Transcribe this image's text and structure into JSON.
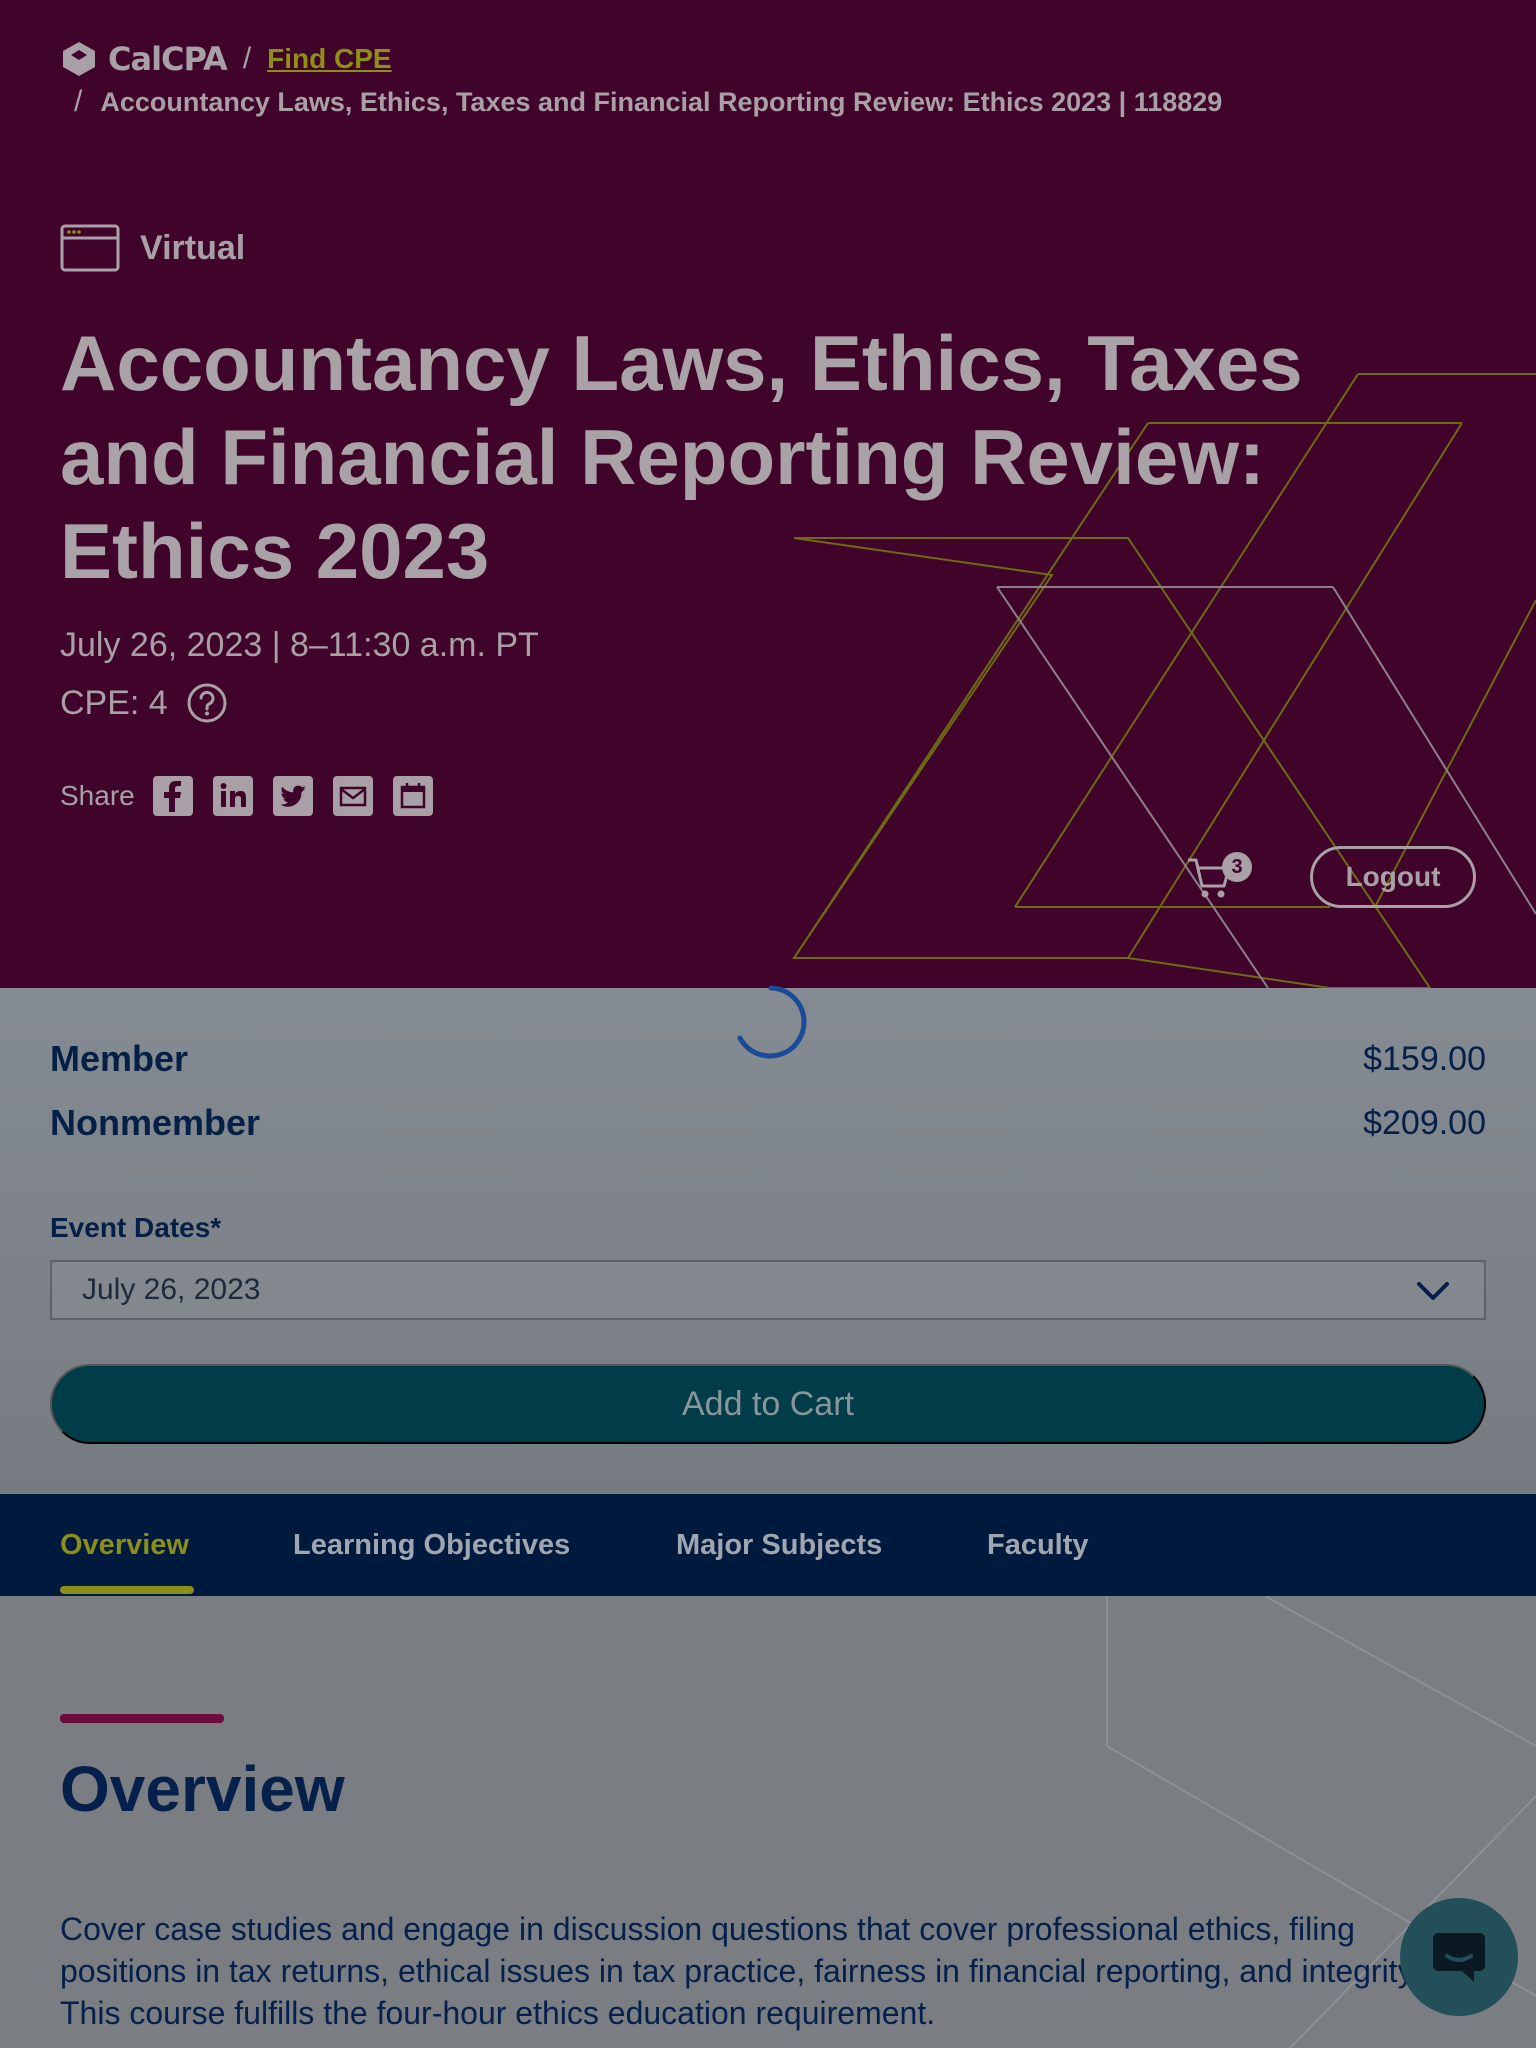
{
  "breadcrumb": {
    "logo_text": "CalCPA",
    "separator": "/",
    "find_cpe": "Find CPE",
    "current": "Accountancy Laws, Ethics, Taxes and Financial Reporting Review: Ethics 2023 | 118829"
  },
  "course": {
    "format": "Virtual",
    "title": "Accountancy Laws, Ethics, Taxes and Financial Reporting Review: Ethics 2023",
    "date_time": "July 26, 2023 | 8–11:30 a.m. PT",
    "cpe": "CPE: 4"
  },
  "share": {
    "label": "Share",
    "icons": [
      "facebook-icon",
      "linkedin-icon",
      "twitter-icon",
      "email-icon",
      "calendar-icon"
    ]
  },
  "header_actions": {
    "cart_count": "3",
    "logout_label": "Logout"
  },
  "pricing": {
    "member_label": "Member",
    "member_price": "$159.00",
    "nonmember_label": "Nonmember",
    "nonmember_price": "$209.00"
  },
  "event_dates": {
    "label": "Event Dates*",
    "selected": "July 26, 2023"
  },
  "add_to_cart_label": "Add to Cart",
  "tabs": [
    {
      "label": "Overview",
      "active": true
    },
    {
      "label": "Learning Objectives",
      "active": false
    },
    {
      "label": "Major Subjects",
      "active": false
    },
    {
      "label": "Faculty",
      "active": false
    }
  ],
  "overview": {
    "heading": "Overview",
    "text": "Cover case studies and engage in discussion questions that cover professional ethics, filing positions in tax returns, ethical issues in tax practice, fairness in financial reporting, and integrity. This course fulfills the four-hour ethics education requirement."
  },
  "colors": {
    "hero_bg": "#40042a",
    "accent_olive": "#8b8e19",
    "navy": "#05204a",
    "teal_button": "#003d49",
    "tab_bar": "#001a3d"
  }
}
